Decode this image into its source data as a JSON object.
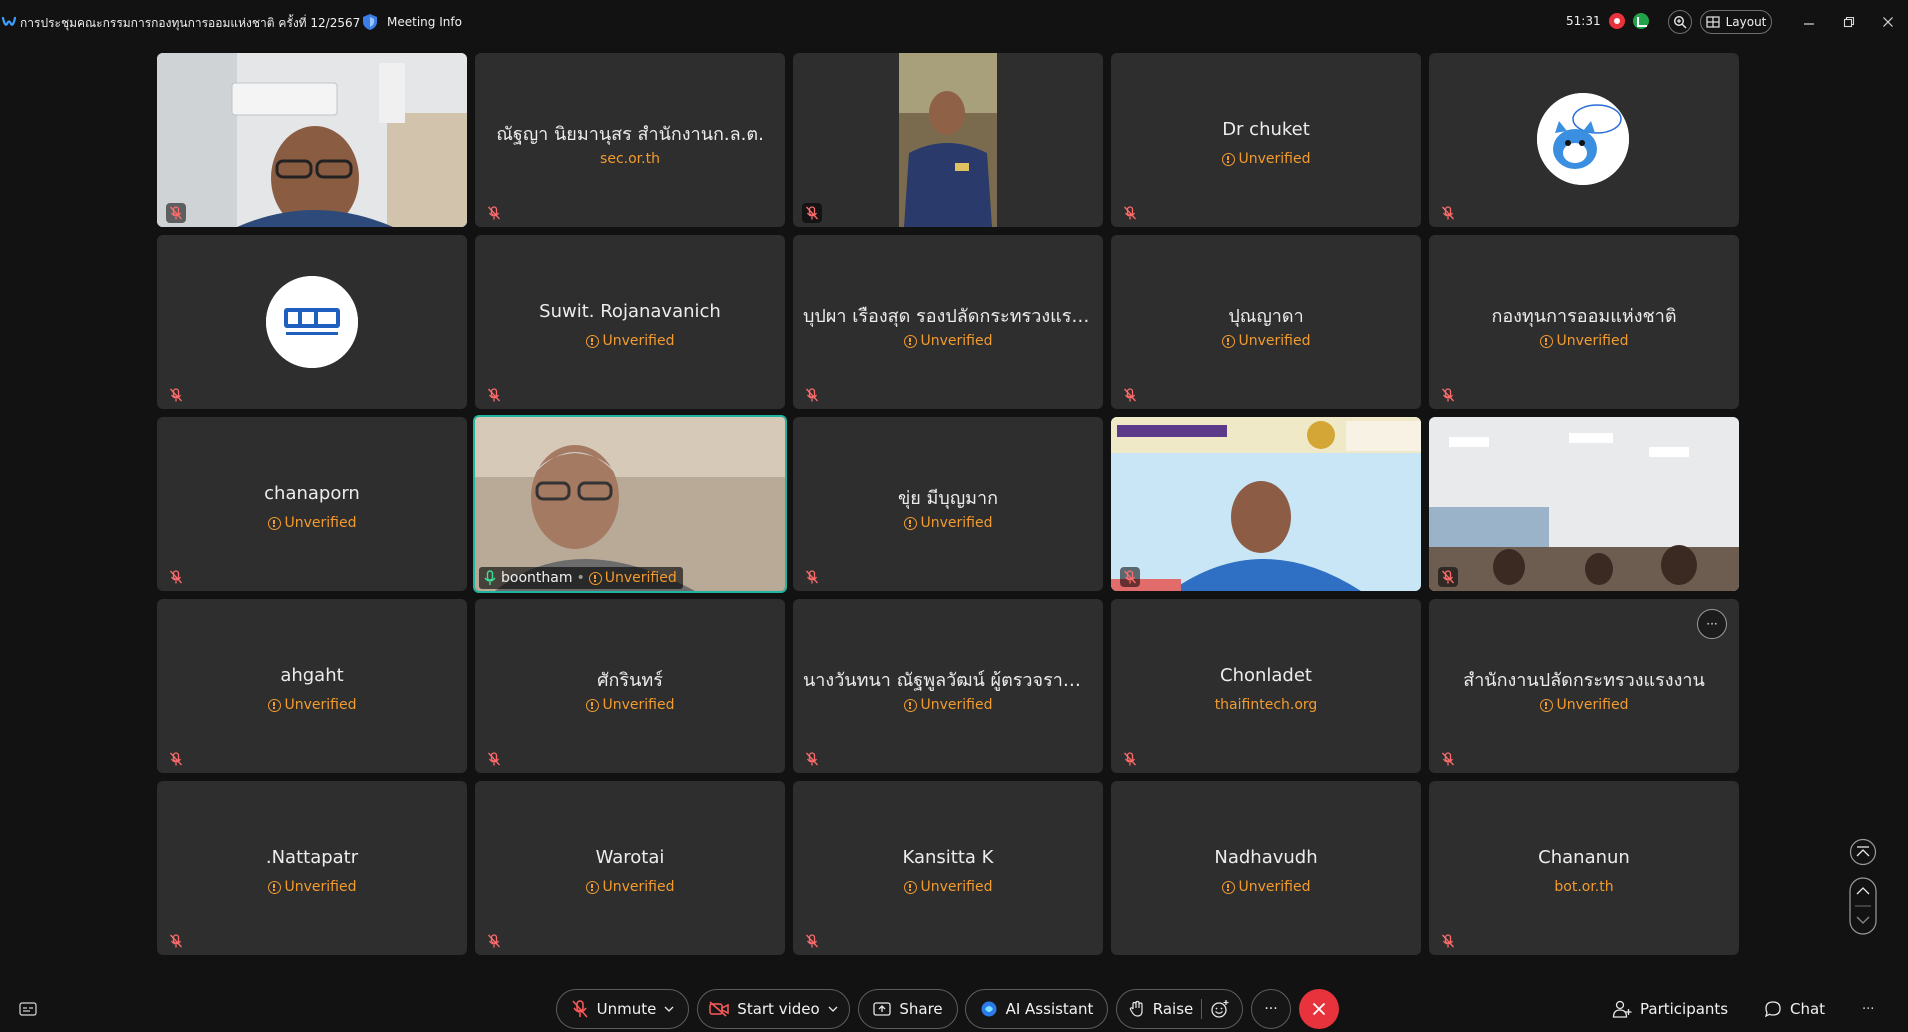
{
  "window": {
    "title": "การประชุมคณะกรรมการกองทุนการออมแห่งชาติ ครั้งที่ 12/2567",
    "meeting_info_label": "Meeting Info",
    "timer": "51:31",
    "layout_label": "Layout"
  },
  "colors": {
    "background": "#121212",
    "tile": "#2e2e2e",
    "unverified": "#f29b2e",
    "active_speaker": "#1fb5a2",
    "end_call": "#e8333d"
  },
  "participants": [
    {
      "name": "",
      "sub": "",
      "kind": "video"
    },
    {
      "name": "ณัฐญา นิยมานุสร สำนักงานก.ล.ต.",
      "sub": "sec.or.th",
      "kind": "name"
    },
    {
      "name": "",
      "sub": "",
      "kind": "video"
    },
    {
      "name": "Dr chuket",
      "sub": "Unverified",
      "kind": "name"
    },
    {
      "name": "",
      "sub": "",
      "kind": "avatar"
    },
    {
      "name": "",
      "sub": "",
      "kind": "avatar"
    },
    {
      "name": "Suwit. Rojanavanich",
      "sub": "Unverified",
      "kind": "name"
    },
    {
      "name": "บุปผา เรืองสุด รองปลัดกระทรวงแรง...",
      "sub": "Unverified",
      "kind": "name"
    },
    {
      "name": "ปุณญาดา",
      "sub": "Unverified",
      "kind": "name"
    },
    {
      "name": "กองทุนการออมแห่งชาติ",
      "sub": "Unverified",
      "kind": "name"
    },
    {
      "name": "chanaporn",
      "sub": "Unverified",
      "kind": "name"
    },
    {
      "name": "boontham",
      "sub": "Unverified",
      "kind": "video"
    },
    {
      "name": "ขุ่ย  มีบุญมาก",
      "sub": "Unverified",
      "kind": "name"
    },
    {
      "name": "",
      "sub": "",
      "kind": "video"
    },
    {
      "name": "",
      "sub": "",
      "kind": "video"
    },
    {
      "name": "ahgaht",
      "sub": "Unverified",
      "kind": "name"
    },
    {
      "name": "ศักรินทร์",
      "sub": "Unverified",
      "kind": "name"
    },
    {
      "name": "นางวันทนา ณัฐพูลวัฒน์ ผู้ตรวจราชก...",
      "sub": "Unverified",
      "kind": "name"
    },
    {
      "name": "Chonladet",
      "sub": "thaifintech.org",
      "kind": "name"
    },
    {
      "name": "สำนักงานปลัดกระทรวงแรงงาน",
      "sub": "Unverified",
      "kind": "name"
    },
    {
      "name": ".Nattapatr",
      "sub": "Unverified",
      "kind": "name"
    },
    {
      "name": "Warotai",
      "sub": "Unverified",
      "kind": "name"
    },
    {
      "name": "Kansitta K",
      "sub": "Unverified",
      "kind": "name"
    },
    {
      "name": "Nadhavudh",
      "sub": "Unverified",
      "kind": "name"
    },
    {
      "name": "Chananun",
      "sub": "bot.or.th",
      "kind": "name"
    }
  ],
  "tile_more_label": "···",
  "toolbar": {
    "unmute": "Unmute",
    "start_video": "Start video",
    "share": "Share",
    "ai_assistant": "AI Assistant",
    "raise": "Raise",
    "more": "···",
    "participants": "Participants",
    "chat": "Chat",
    "overflow": "···"
  },
  "icons": {
    "app": "webex-logo-icon",
    "info": "shield-icon",
    "mic_muted": "mic-muted-icon",
    "captions": "captions-icon"
  }
}
